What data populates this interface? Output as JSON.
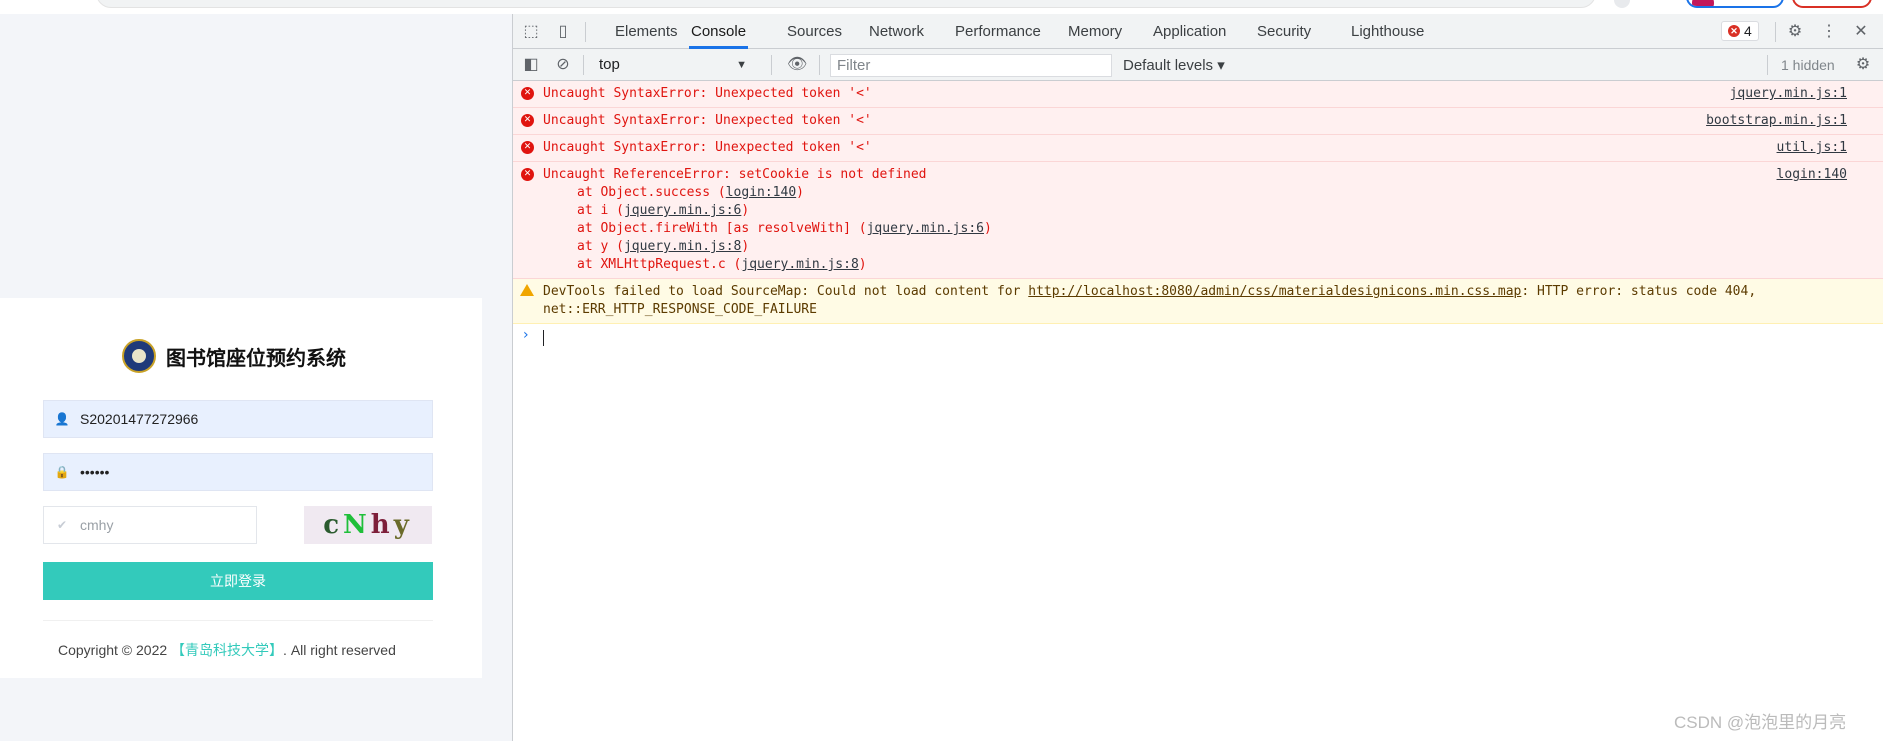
{
  "devtools": {
    "tabs": [
      {
        "label": "Elements"
      },
      {
        "label": "Console"
      },
      {
        "label": "Sources"
      },
      {
        "label": "Network"
      },
      {
        "label": "Performance"
      },
      {
        "label": "Memory"
      },
      {
        "label": "Application"
      },
      {
        "label": "Security"
      },
      {
        "label": "Lighthouse"
      }
    ],
    "active_tab": "Console",
    "error_count": "4",
    "toolbar": {
      "context": "top",
      "filter_placeholder": "Filter",
      "levels": "Default levels",
      "hidden": "1 hidden"
    },
    "messages": [
      {
        "level": "error",
        "text": "Uncaught SyntaxError: Unexpected token '<'",
        "source": "jquery.min.js:1"
      },
      {
        "level": "error",
        "text": "Uncaught SyntaxError: Unexpected token '<'",
        "source": "bootstrap.min.js:1"
      },
      {
        "level": "error",
        "text": "Uncaught SyntaxError: Unexpected token '<'",
        "source": "util.js:1"
      },
      {
        "level": "error",
        "text": "Uncaught ReferenceError: setCookie is not defined",
        "source": "login:140",
        "stack": [
          {
            "pre": "at Object.success (",
            "link": "login:140",
            "post": ")"
          },
          {
            "pre": "at i (",
            "link": "jquery.min.js:6",
            "post": ")"
          },
          {
            "pre": "at Object.fireWith [as resolveWith] (",
            "link": "jquery.min.js:6",
            "post": ")"
          },
          {
            "pre": "at y (",
            "link": "jquery.min.js:8",
            "post": ")"
          },
          {
            "pre": "at XMLHttpRequest.c (",
            "link": "jquery.min.js:8",
            "post": ")"
          }
        ]
      },
      {
        "level": "warning",
        "pre": "DevTools failed to load SourceMap: Could not load content for ",
        "link": "http://localhost:8080/admin/css/materialdesignicons.min.css.map",
        "post": ": HTTP error: status code 404, net::ERR_HTTP_RESPONSE_CODE_FAILURE"
      }
    ]
  },
  "login": {
    "title": "图书馆座位预约系统",
    "username_value": "S20201477272966",
    "password_value": "••••••",
    "captcha_placeholder": "cmhy",
    "captcha_chars": [
      "c",
      "N",
      "h",
      "y"
    ],
    "submit_label": "立即登录",
    "copyright_pre": "Copyright © 2022 ",
    "copyright_school": "【青岛科技大学】",
    "copyright_post": ". All right reserved"
  },
  "watermark": "CSDN @泡泡里的月亮",
  "colors": {
    "accent": "#33cabb",
    "devtools_blue": "#1a73e8",
    "error_red": "#e0140f",
    "error_bg": "#fff0f0",
    "warn_bg": "#fffbe5"
  }
}
